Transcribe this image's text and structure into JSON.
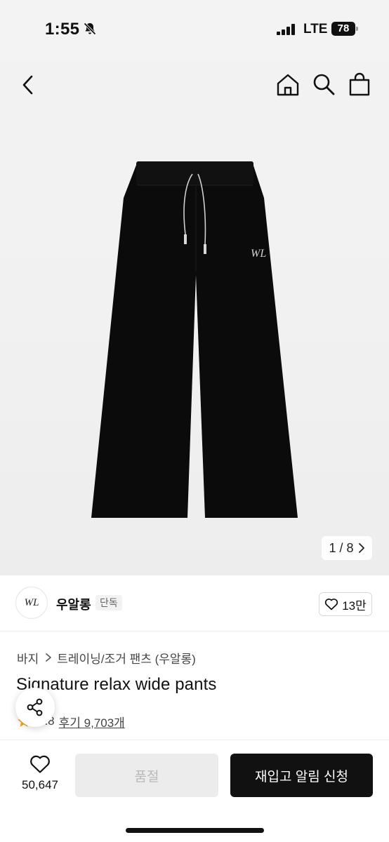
{
  "status_bar": {
    "time": "1:55",
    "network": "LTE",
    "battery": "78"
  },
  "nav": {
    "back_icon": "chevron-left-icon",
    "home_icon": "home-icon",
    "search_icon": "search-icon",
    "bag_icon": "shopping-bag-icon"
  },
  "gallery": {
    "pager": "1 / 8",
    "image_logo": "WL"
  },
  "brand": {
    "logo": "WL",
    "name": "우알롱",
    "badge": "단독",
    "like_count": "13만"
  },
  "product": {
    "breadcrumb": [
      "바지",
      "트레이닝/조거 팬츠 (우알롱)"
    ],
    "title": "Signature relax wide pants",
    "rating": "4.8",
    "reviews": "후기 9,703개"
  },
  "bottom_bar": {
    "wish_count": "50,647",
    "soldout_label": "품절",
    "restock_label": "재입고 알림 신청"
  },
  "colors": {
    "accent_star": "#f5a623",
    "primary_button": "#111111",
    "disabled_button": "#ececec"
  }
}
